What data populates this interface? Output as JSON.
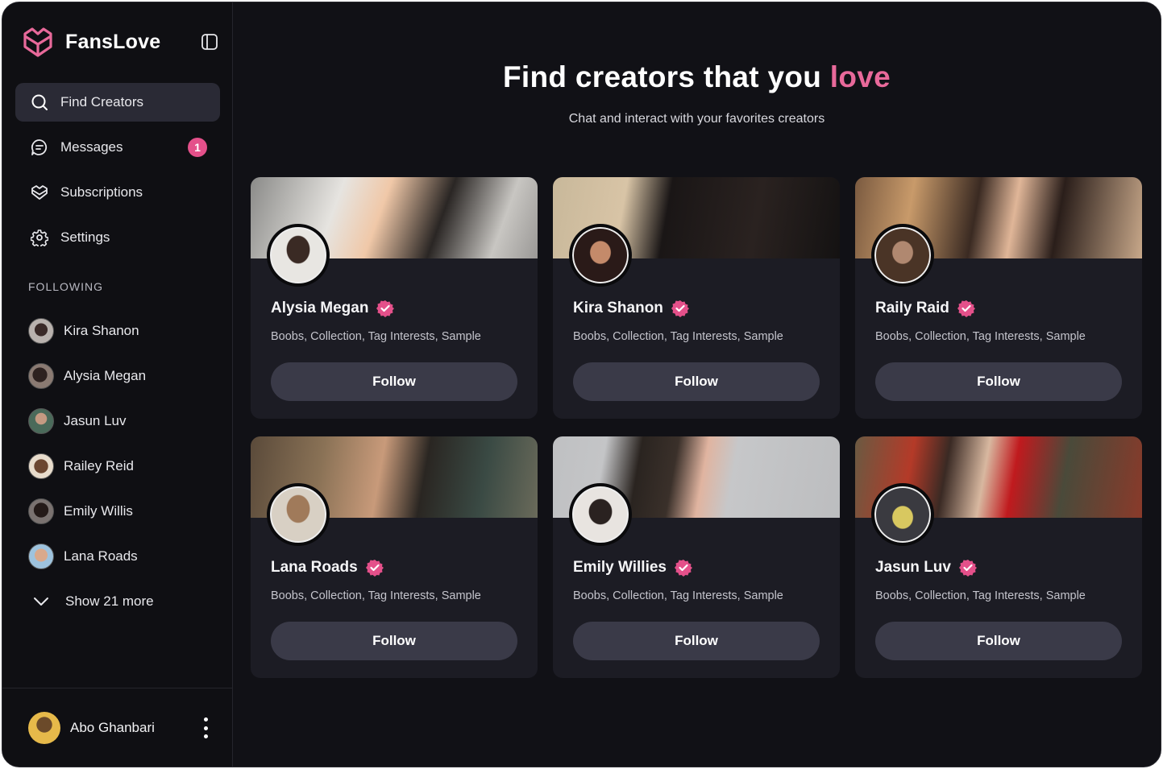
{
  "app": {
    "brand": "FansLove",
    "accent_color": "#e8699a",
    "badge_color": "#e4508a"
  },
  "sidebar": {
    "nav": [
      {
        "label": "Find Creators",
        "icon": "search-icon",
        "active": true
      },
      {
        "label": "Messages",
        "icon": "message-icon",
        "badge": "1"
      },
      {
        "label": "Subscriptions",
        "icon": "heart-box-icon"
      },
      {
        "label": "Settings",
        "icon": "gear-icon"
      }
    ],
    "following_label": "FOLLOWING",
    "following": [
      {
        "name": "Kira Shanon"
      },
      {
        "name": "Alysia Megan"
      },
      {
        "name": "Jasun Luv"
      },
      {
        "name": "Railey Reid"
      },
      {
        "name": "Emily Willis"
      },
      {
        "name": "Lana Roads"
      }
    ],
    "show_more": "Show 21 more",
    "user": {
      "name": "Abo Ghanbari"
    }
  },
  "main": {
    "headline_prefix": "Find creators that you ",
    "headline_accent": "love",
    "subtitle": "Chat and interact with your favorites creators",
    "cards": [
      {
        "name": "Alysia Megan",
        "tags": "Boobs, Collection, Tag Interests, Sample",
        "button": "Follow"
      },
      {
        "name": "Kira Shanon",
        "tags": "Boobs, Collection, Tag Interests, Sample",
        "button": "Follow"
      },
      {
        "name": "Raily Raid",
        "tags": "Boobs, Collection, Tag Interests, Sample",
        "button": "Follow"
      },
      {
        "name": "Lana Roads",
        "tags": "Boobs, Collection, Tag Interests, Sample",
        "button": "Follow"
      },
      {
        "name": "Emily Willies",
        "tags": "Boobs, Collection, Tag Interests, Sample",
        "button": "Follow"
      },
      {
        "name": "Jasun Luv",
        "tags": "Boobs, Collection, Tag Interests, Sample",
        "button": "Follow"
      }
    ]
  }
}
